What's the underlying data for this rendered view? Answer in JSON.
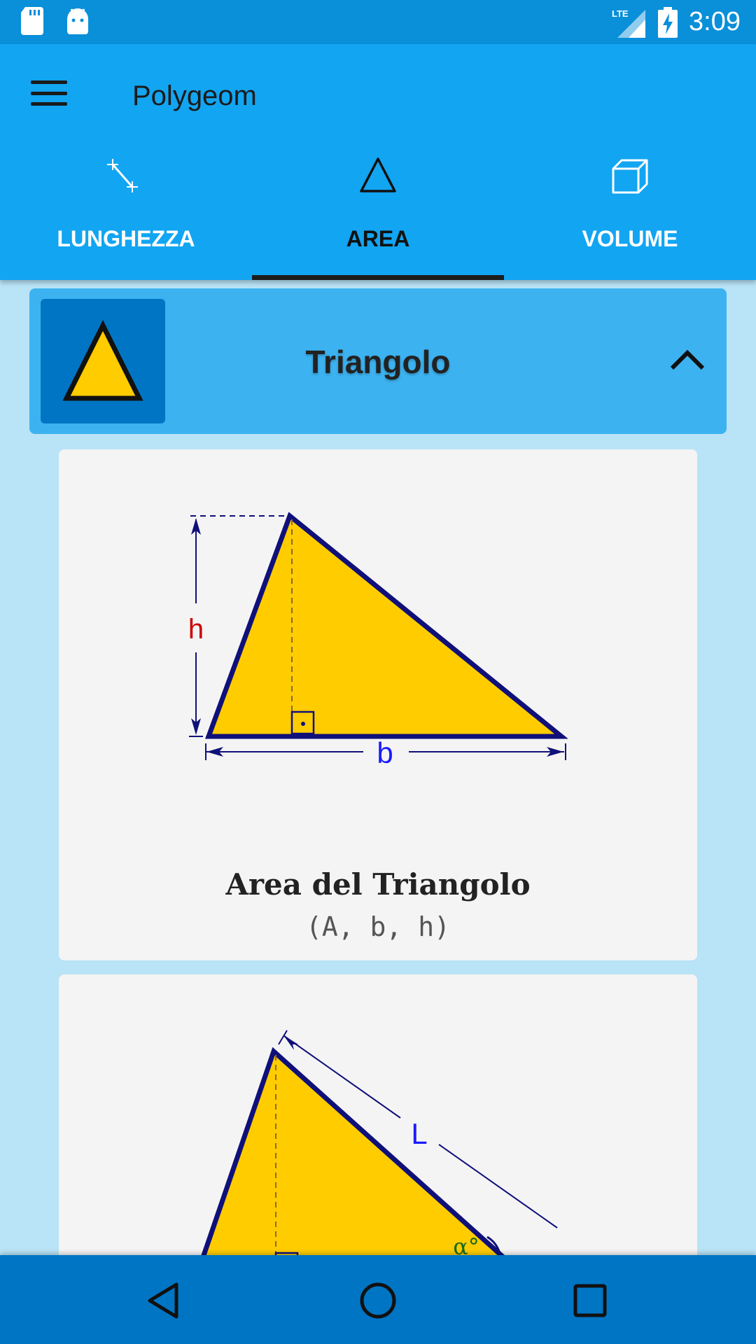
{
  "status_bar": {
    "time": "3:09",
    "network": "LTE",
    "icons": [
      "sd-card-icon",
      "android-icon",
      "lte-signal-icon",
      "battery-charging-icon"
    ]
  },
  "app_bar": {
    "title": "Polygeom",
    "menu_icon": "hamburger-menu-icon"
  },
  "tabs": [
    {
      "label": "LUNGHEZZA",
      "icon": "segment-icon",
      "active": false
    },
    {
      "label": "AREA",
      "icon": "triangle-outline-icon",
      "active": true
    },
    {
      "label": "VOLUME",
      "icon": "cube-icon",
      "active": false
    }
  ],
  "shape_header": {
    "title": "Triangolo",
    "thumb_icon": "triangle-icon",
    "toggle_icon": "chevron-up-icon"
  },
  "cards": [
    {
      "diagram_labels": {
        "height": "h",
        "base": "b"
      },
      "title": "Area del Triangolo",
      "subtitle": "(A, b, h)"
    },
    {
      "diagram_labels": {
        "side": "L",
        "angle": "α°"
      }
    }
  ],
  "nav_bar": {
    "icons": [
      "back-icon",
      "home-icon",
      "recents-icon"
    ]
  },
  "colors": {
    "status_bar": "#0a8fd9",
    "app_bar": "#12a5f2",
    "header": "#3db2f0",
    "thumb": "#0075c4",
    "background": "#b9e3f6",
    "triangle_fill": "#ffcc00",
    "triangle_stroke": "#10107a",
    "nav_bar": "#0075c4"
  }
}
